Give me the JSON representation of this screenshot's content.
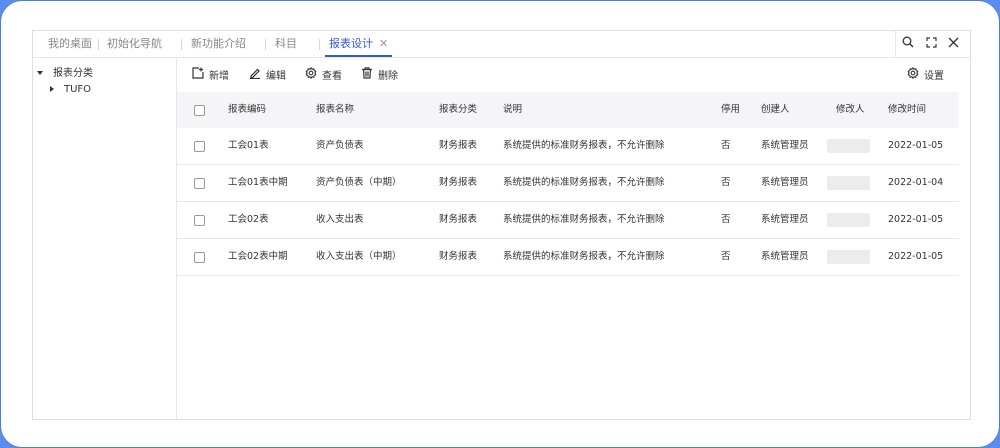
{
  "tabs": [
    {
      "label": "我的桌面"
    },
    {
      "label": "初始化导航"
    },
    {
      "label": "新功能介绍"
    },
    {
      "label": "科目"
    },
    {
      "label": "报表设计",
      "close": "✕"
    }
  ],
  "sidebar": {
    "root": {
      "label": "报表分类"
    },
    "child": {
      "label": "TUFO"
    }
  },
  "toolbar": {
    "add_label": "新增",
    "edit_label": "编辑",
    "view_label": "查看",
    "delete_label": "删除",
    "settings_label": "设置"
  },
  "table": {
    "columns": [
      "报表编码",
      "报表名称",
      "报表分类",
      "说明",
      "停用",
      "创建人",
      "修改人",
      "修改时间"
    ],
    "rows": [
      {
        "code": "工会01表",
        "name": "资产负债表",
        "category": "财务报表",
        "desc": "系统提供的标准财务报表，不允许删除",
        "disabled": "否",
        "creator": "系统管理员",
        "modified": "2022-01-05"
      },
      {
        "code": "工会01表中期",
        "name": "资产负债表（中期）",
        "category": "财务报表",
        "desc": "系统提供的标准财务报表，不允许删除",
        "disabled": "否",
        "creator": "系统管理员",
        "modified": "2022-01-04"
      },
      {
        "code": "工会02表",
        "name": "收入支出表",
        "category": "财务报表",
        "desc": "系统提供的标准财务报表，不允许删除",
        "disabled": "否",
        "creator": "系统管理员",
        "modified": "2022-01-05"
      },
      {
        "code": "工会02表中期",
        "name": "收入支出表（中期）",
        "category": "财务报表",
        "desc": "系统提供的标准财务报表，不允许删除",
        "disabled": "否",
        "creator": "系统管理员",
        "modified": "2022-01-05"
      }
    ]
  },
  "colors": {
    "accent": "#2f5bd3",
    "frame": "#5b8def",
    "header_bg": "#f5f5f7"
  },
  "icons": [
    "search-icon",
    "expand-icon",
    "close-icon",
    "add-icon",
    "edit-icon",
    "gear-icon",
    "trash-icon"
  ]
}
